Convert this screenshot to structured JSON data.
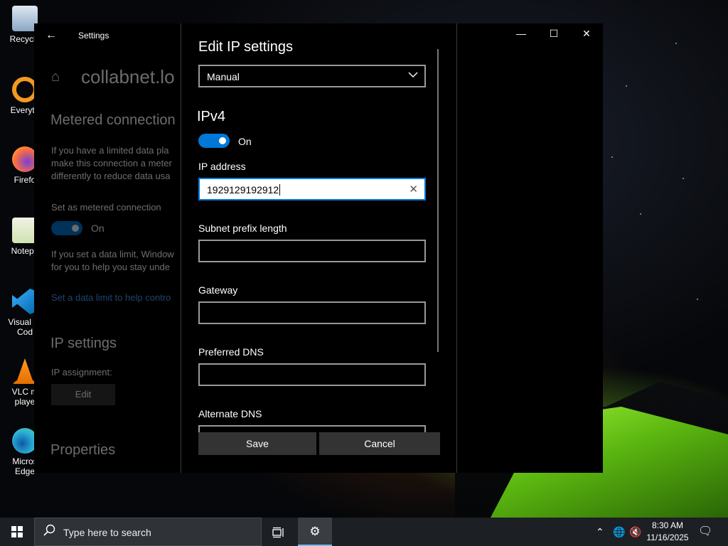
{
  "desktop": {
    "icons": [
      {
        "label": "Recycle",
        "icon": "recycle-bin-icon",
        "color": "#9fbfe0"
      },
      {
        "label": "Everyth",
        "icon": "everything-search-icon",
        "color": "#f39a1e"
      },
      {
        "label": "Firefo",
        "icon": "firefox-icon",
        "color": "#ff7139"
      },
      {
        "label": "Notepa",
        "icon": "notepad-plus-plus-icon",
        "color": "#9ad16b"
      },
      {
        "label": "Visual St",
        "label2": "Cod",
        "icon": "vscode-icon",
        "color": "#2a9bf0"
      },
      {
        "label": "VLC m",
        "label2": "playe",
        "icon": "vlc-icon",
        "color": "#f58a16"
      },
      {
        "label": "Micros",
        "label2": "Edge",
        "icon": "edge-icon",
        "color": "#2fb3d9"
      }
    ]
  },
  "settings_window": {
    "title": "Settings",
    "page_title": "collabnet.lo",
    "metered_heading": "Metered connection",
    "metered_desc": [
      "If you have a limited data pla",
      "make this connection a meter",
      "differently to reduce data usa"
    ],
    "metered_toggle_label": "Set as metered connection",
    "metered_toggle_state": "On",
    "data_limit_desc": [
      "If you set a data limit, Window",
      "for you to help you stay unde"
    ],
    "data_limit_link": "Set a data limit to help contro",
    "ip_heading": "IP settings",
    "ip_assignment_label": "IP assignment:",
    "edit_button": "Edit",
    "properties_heading": "Properties"
  },
  "dialog": {
    "title": "Edit IP settings",
    "mode_select": "Manual",
    "section": "IPv4",
    "ipv4_toggle": "On",
    "fields": {
      "ip_address": {
        "label": "IP address",
        "value": "1929129192912"
      },
      "subnet": {
        "label": "Subnet prefix length",
        "value": ""
      },
      "gateway": {
        "label": "Gateway",
        "value": ""
      },
      "preferred_dns": {
        "label": "Preferred DNS",
        "value": ""
      },
      "alternate_dns": {
        "label": "Alternate DNS",
        "value": ""
      }
    },
    "save": "Save",
    "cancel": "Cancel"
  },
  "taskbar": {
    "search_placeholder": "Type here to search",
    "time": "8:30 AM",
    "date": "11/16/2025"
  },
  "colors": {
    "accent": "#0078d7",
    "window_bg": "#000000",
    "taskbar_bg": "#1c1f24"
  }
}
